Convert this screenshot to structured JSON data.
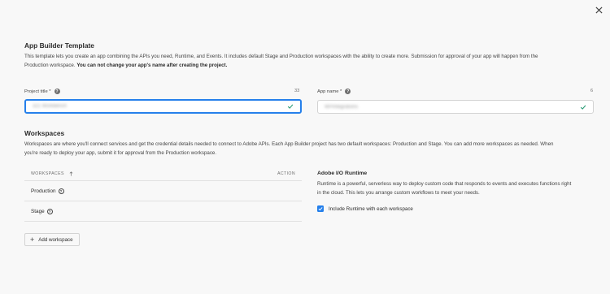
{
  "template": {
    "title": "App Builder Template",
    "desc_line1": "This template lets you create an app combining the APIs you need, Runtime, and Events. It includes default Stage and Production workspaces with the ability to create more. Submission for approval of your app will happen from the",
    "desc_line2": "Production workspace. ",
    "desc_bold": "You can not change your app's name after creating the project."
  },
  "project_title": {
    "label": "Project title *",
    "count": "33",
    "value": "321 Workbench"
  },
  "app_name": {
    "label": "App name *",
    "count": "6",
    "value": "WPIntegrations"
  },
  "workspaces": {
    "title": "Workspaces",
    "desc_line1": "Workspaces are where you'll connect services and get the credential details needed to connect to Adobe APIs. Each App Builder project has two default workspaces: Production and Stage. You can add more workspaces as needed. When",
    "desc_line2": "you're ready to deploy your app, submit it for approval from the Production workspace."
  },
  "table": {
    "col_workspaces": "WORKSPACES",
    "col_action": "ACTION",
    "rows": [
      {
        "name": "Production"
      },
      {
        "name": "Stage"
      }
    ]
  },
  "add_workspace_label": "Add workspace",
  "runtime": {
    "title": "Adobe I/O Runtime",
    "desc_line1": "Runtime is a powerful, serverless way to deploy custom code that responds to events and executes functions right",
    "desc_line2": "in the cloud. This lets you arrange custom workflows to meet your needs.",
    "checkbox_label": "Include Runtime with each workspace",
    "checked": true
  },
  "colors": {
    "accent": "#2680eb",
    "valid": "#2d9d78"
  },
  "icons": {
    "close": "close-icon",
    "help": "help-icon",
    "check": "checkmark-icon",
    "sort": "arrow-up-icon",
    "info": "info-icon",
    "add": "plus-icon"
  }
}
